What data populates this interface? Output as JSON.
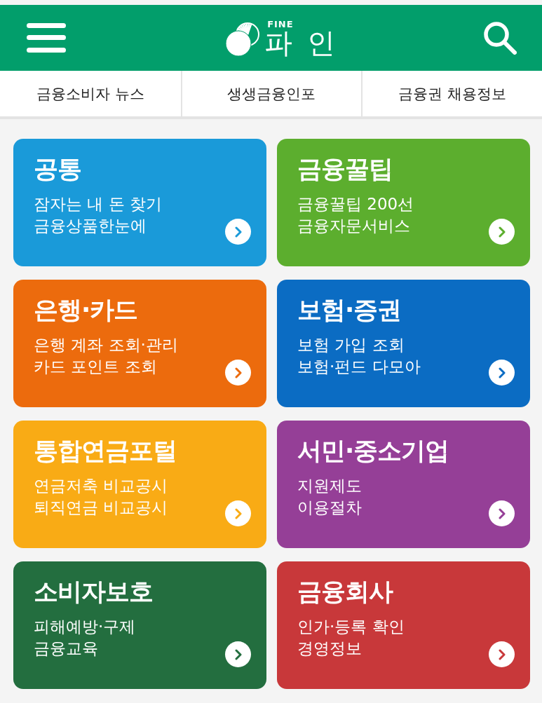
{
  "header": {
    "logo_small": "FINE",
    "logo_text": "파 인"
  },
  "tabs": [
    {
      "label": "금융소비자 뉴스"
    },
    {
      "label": "생생금융인포"
    },
    {
      "label": "금융권 채용정보"
    }
  ],
  "cards": [
    {
      "title": "공통",
      "lines": [
        "잠자는 내 돈 찾기",
        "금융상품한눈에"
      ],
      "color": "#1a9ad9"
    },
    {
      "title": "금융꿀팁",
      "lines": [
        "금융꿀팁 200선",
        "금융자문서비스"
      ],
      "color": "#5cae2e"
    },
    {
      "title": "은행·카드",
      "lines": [
        "은행 계좌 조회·관리",
        "카드 포인트 조회"
      ],
      "color": "#ec6b0d"
    },
    {
      "title": "보험·증권",
      "lines": [
        "보험 가입 조회",
        "보험·펀드 다모아"
      ],
      "color": "#0b6cc3"
    },
    {
      "title": "통합연금포털",
      "lines": [
        "연금저축 비교공시",
        "퇴직연금 비교공시"
      ],
      "color": "#f9ab15"
    },
    {
      "title": "서민·중소기업",
      "lines": [
        "지원제도",
        "이용절차"
      ],
      "color": "#953f97"
    },
    {
      "title": "소비자보호",
      "lines": [
        "피해예방·구제",
        "금융교육"
      ],
      "color": "#236e3f"
    },
    {
      "title": "금융회사",
      "lines": [
        "인가·등록 확인",
        "경영정보"
      ],
      "color": "#c8383a"
    }
  ]
}
